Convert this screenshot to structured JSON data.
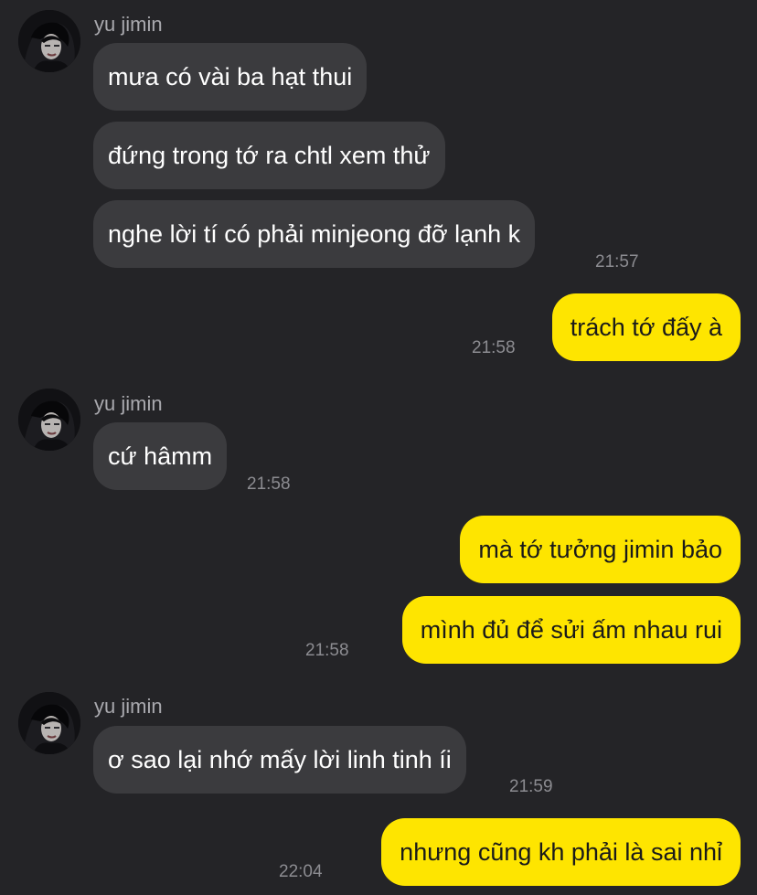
{
  "contact": {
    "name": "yu jimin"
  },
  "messages": [
    {
      "id": "m1",
      "direction": "incoming",
      "text": "mưa có vài ba hạt thui"
    },
    {
      "id": "m2",
      "direction": "incoming",
      "text": "đứng trong tớ ra chtl xem thử"
    },
    {
      "id": "m3",
      "direction": "incoming",
      "text": "nghe lời tí có phải minjeong đỡ lạnh k",
      "time": "21:57"
    },
    {
      "id": "m4",
      "direction": "outgoing",
      "text": "trách tớ đấy à",
      "time": "21:58"
    },
    {
      "id": "m5",
      "direction": "incoming",
      "text": "cứ hâmm",
      "time": "21:58"
    },
    {
      "id": "m6",
      "direction": "outgoing",
      "text": "mà tớ tưởng jimin bảo"
    },
    {
      "id": "m7",
      "direction": "outgoing",
      "text": "mình đủ để sửi ấm nhau rui",
      "time": "21:58"
    },
    {
      "id": "m8",
      "direction": "incoming",
      "text": "ơ sao lại nhớ mấy lời linh tinh íi",
      "time": "21:59"
    },
    {
      "id": "m9",
      "direction": "outgoing",
      "text": "nhưng cũng kh phải là sai nhỉ",
      "time": "22:04"
    }
  ],
  "colors": {
    "background": "#242427",
    "incoming_bubble": "#3b3b3e",
    "outgoing_bubble": "#fee500",
    "timestamp": "#8c8c91",
    "sender_name": "#a9a9ae"
  },
  "icons": {
    "avatar": "avatar-photo"
  }
}
